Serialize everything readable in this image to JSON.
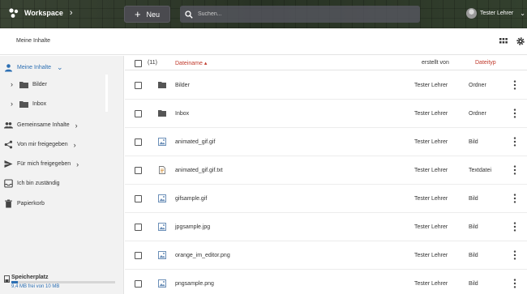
{
  "header": {
    "workspace_title": "Workspace",
    "new_button_label": "Neu",
    "search_placeholder": "Suchen...",
    "user_name": "Tester Lehrer"
  },
  "breadcrumb": {
    "current": "Meine Inhalte"
  },
  "sidebar": {
    "items": [
      {
        "label": "Meine Inhalte",
        "icon": "user-icon",
        "active": true
      },
      {
        "label": "Gemeinsame Inhalte",
        "icon": "group-icon"
      },
      {
        "label": "Von mir freigegeben",
        "icon": "share-icon"
      },
      {
        "label": "Für mich freigegeben",
        "icon": "send-icon"
      },
      {
        "label": "Ich bin zuständig",
        "icon": "inbox-icon"
      },
      {
        "label": "Papierkorb",
        "icon": "trash-icon"
      }
    ],
    "tree": [
      {
        "label": "Bilder"
      },
      {
        "label": "Inbox"
      }
    ],
    "storage": {
      "label": "Speicherplatz",
      "free_text": "9,4 MB frei von 10 MB",
      "used_fraction": 0.06
    }
  },
  "table": {
    "count": "(11)",
    "col_name": "Dateiname",
    "col_creator": "erstellt von",
    "col_type": "Dateityp",
    "rows": [
      {
        "name": "Bilder",
        "creator": "Tester Lehrer",
        "type": "Ordner",
        "icon": "folder-icon"
      },
      {
        "name": "Inbox",
        "creator": "Tester Lehrer",
        "type": "Ordner",
        "icon": "folder-icon"
      },
      {
        "name": "animated_gif.gif",
        "creator": "Tester Lehrer",
        "type": "Bild",
        "icon": "image-icon"
      },
      {
        "name": "animated_gif.gif.txt",
        "creator": "Tester Lehrer",
        "type": "Textdatei",
        "icon": "text-file-icon"
      },
      {
        "name": "gifsample.gif",
        "creator": "Tester Lehrer",
        "type": "Bild",
        "icon": "image-icon"
      },
      {
        "name": "jpgsample.jpg",
        "creator": "Tester Lehrer",
        "type": "Bild",
        "icon": "image-icon"
      },
      {
        "name": "orange_im_editor.png",
        "creator": "Tester Lehrer",
        "type": "Bild",
        "icon": "image-icon"
      },
      {
        "name": "pngsample.png",
        "creator": "Tester Lehrer",
        "type": "Bild",
        "icon": "image-icon"
      }
    ]
  },
  "colors": {
    "accent": "#2c6fb3",
    "sort_header": "#c0392b"
  }
}
